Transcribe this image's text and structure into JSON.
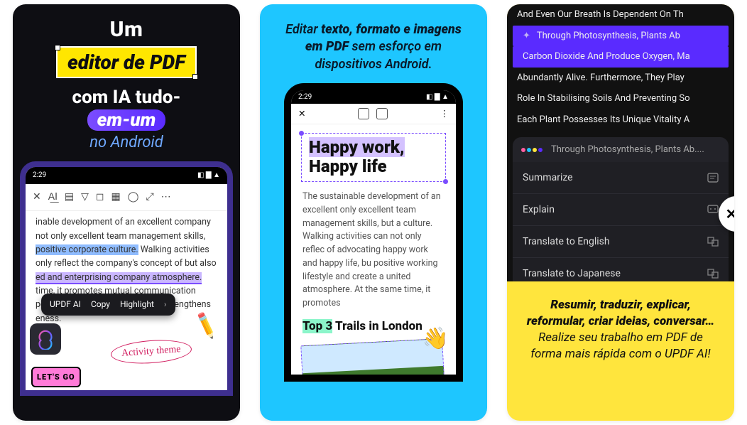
{
  "card1": {
    "line1": "Um",
    "line2": "editor de PDF",
    "line3": "com IA tudo-",
    "line4": "em-um",
    "line5": "no Android",
    "statusTime": "2:29",
    "toolbarIcons": [
      "✕",
      "A͟I",
      "▤",
      "▽",
      "◻",
      "▦",
      "◯",
      "⤢",
      "⋯"
    ],
    "docHtmlParts": {
      "t0": "inable development of an excellent company not only excellent team management skills, ",
      "hl1": "positive corporate culture.",
      "t1": " Walking activities only reflect the company's concept of                      but also ",
      "hl2": "ed and enterprising company atmosphere.",
      "t2": " time, it promotes mutual communication poration among employees, and strengthens eness."
    },
    "contextMenu": [
      "UPDF AI",
      "Copy",
      "Highlight",
      "›"
    ],
    "handnote": "Activity theme",
    "letsgo": "LET'S GO"
  },
  "card2": {
    "headline_b": "texto, formato e imagens em PDF",
    "headline_pre": "Editar ",
    "headline_post": " sem esforço em dispositivos Android.",
    "statusTime": "2:29",
    "h1_hl": "Happy work,",
    "h1_b": "Happy life",
    "para": "The sustainable development of an excellent only excellent team management skills, but a culture. Walking activities can not only reflec of advocating happy work and happy life, bu positive working lifestyle and create a united atmosphere. At the same time, it promotes",
    "sub_hl": "Top 3",
    "sub_rest": " Trails in London"
  },
  "card3": {
    "lines": [
      "And Even Our Breath Is Dependent On Th",
      "Through Photosynthesis, Plants Ab",
      "Carbon Dioxide And Produce Oxygen, Ma",
      "Abundantly Alive. Furthermore, They Play",
      "Role In Stabilising Soils And Preventing So",
      "Each Plant Possesses Its Unique Vitality A"
    ],
    "aiPreview": "Through Photosynthesis, Plants Ab....",
    "menu": [
      "Summarize",
      "Explain",
      "Translate to English",
      "Translate to Japanese"
    ],
    "caption_b": "Resumir, traduzir, explicar, reformular, criar ideias, conversar…",
    "caption_i": "Realize seu trabalho em PDF de forma mais rápida com o UPDF AI!"
  }
}
